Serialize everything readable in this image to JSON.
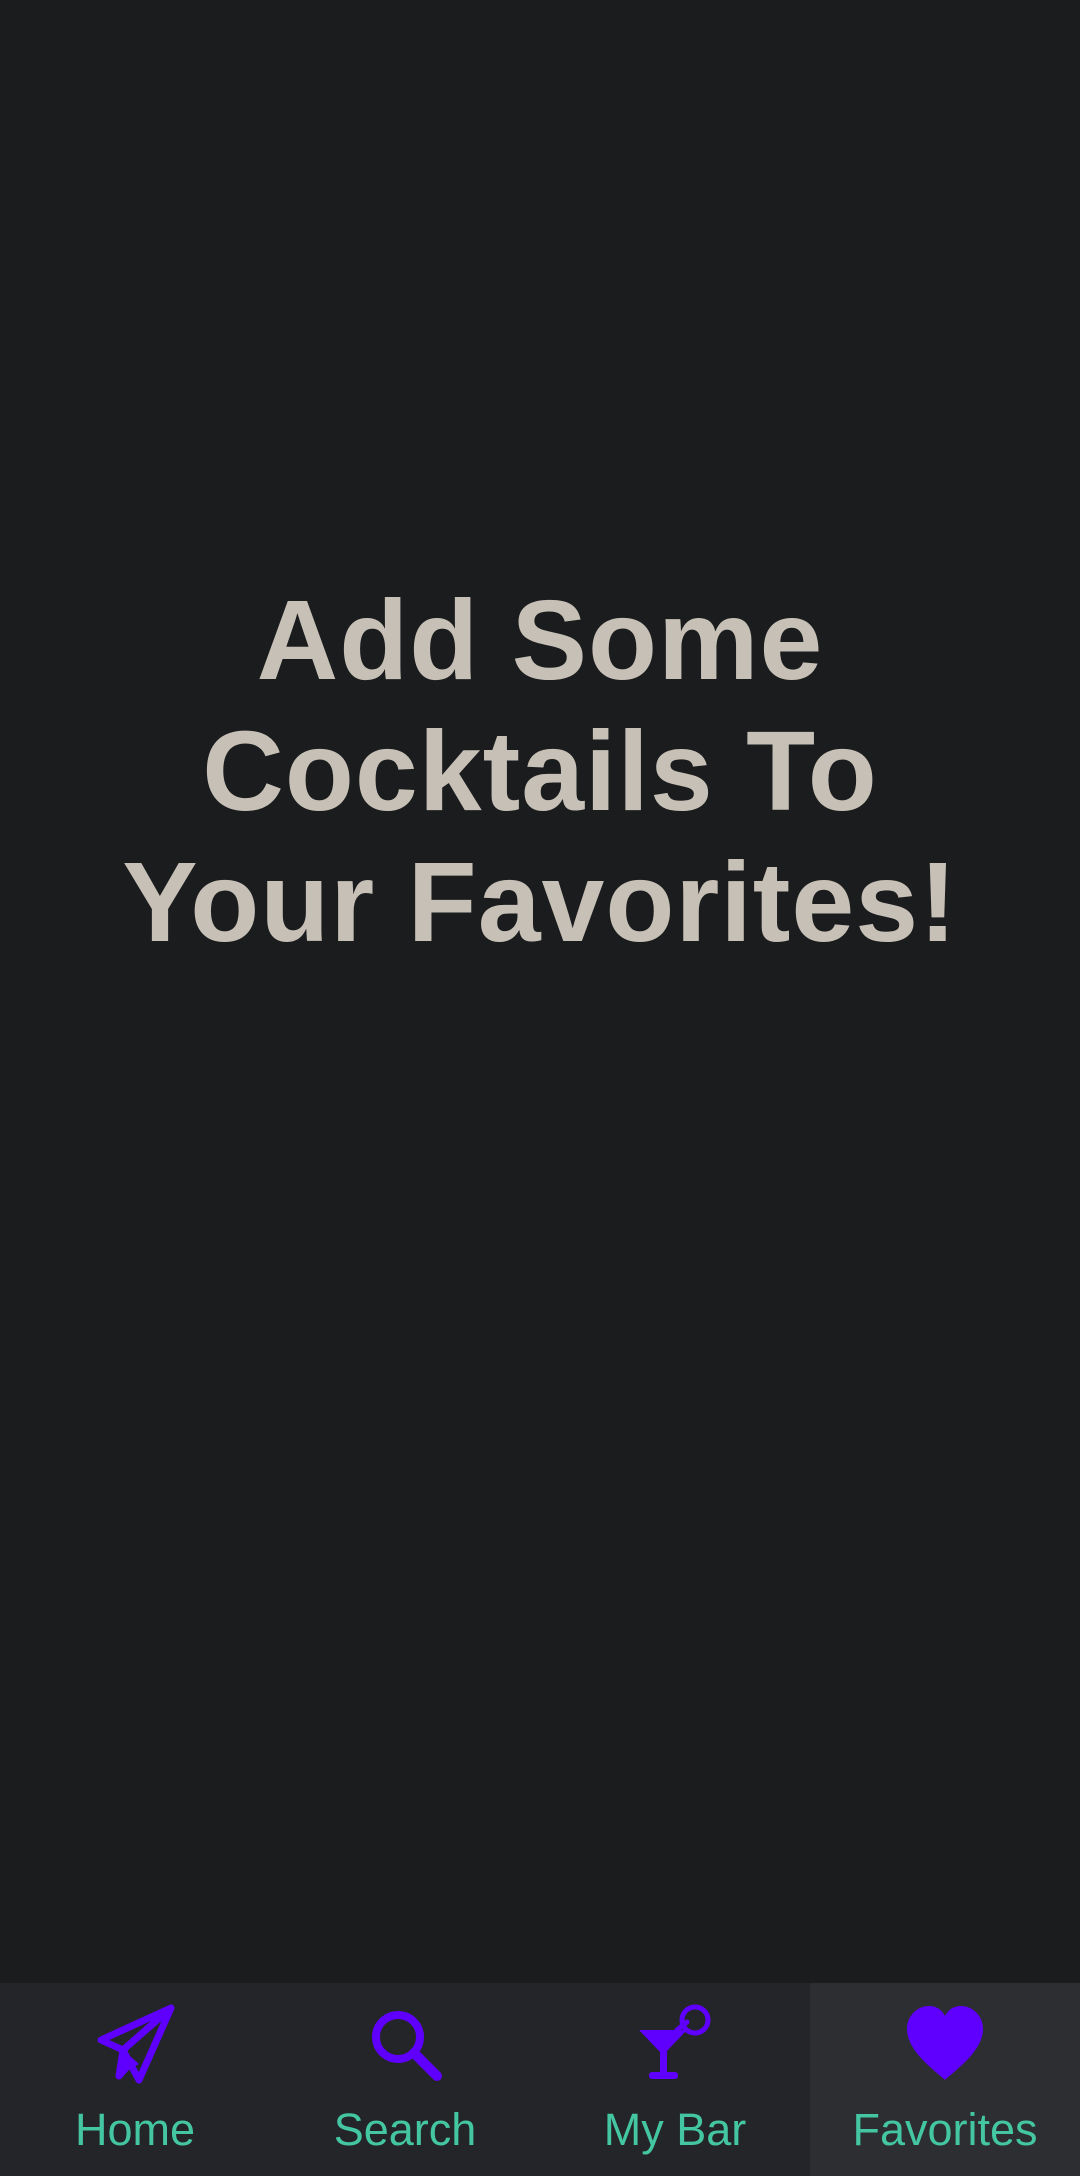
{
  "main": {
    "empty_message": "Add Some Cocktails To Your Favorites!"
  },
  "bottom_nav": {
    "active_item": "Favorites",
    "items": [
      {
        "label": "Home",
        "icon": "paper-plane-icon"
      },
      {
        "label": "Search",
        "icon": "search-icon"
      },
      {
        "label": "My Bar",
        "icon": "cocktail-glass-icon"
      },
      {
        "label": "Favorites",
        "icon": "heart-icon"
      }
    ]
  },
  "colors": {
    "background": "#1b1c1e",
    "nav_background": "#242528",
    "nav_active_background": "#2c2e31",
    "icon": "#5f00ff",
    "label": "#43c6a1",
    "message_text": "#c6c0b6"
  }
}
